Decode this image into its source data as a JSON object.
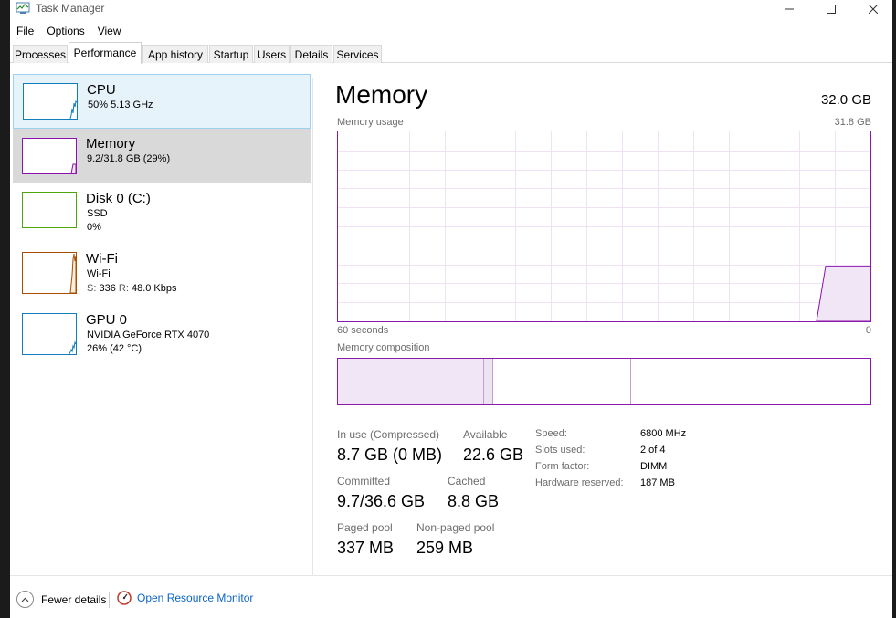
{
  "window": {
    "title": "Task Manager",
    "controls": [
      "minimize",
      "maximize",
      "close"
    ]
  },
  "menu": [
    "File",
    "Options",
    "View"
  ],
  "tabs": [
    "Processes",
    "Performance",
    "App history",
    "Startup",
    "Users",
    "Details",
    "Services"
  ],
  "active_tab": "Performance",
  "resources": [
    {
      "name": "CPU",
      "line1": "50%  5.13 GHz",
      "line2": "",
      "color": "#117dbb"
    },
    {
      "name": "Memory",
      "line1": "9.2/31.8 GB (29%)",
      "line2": "",
      "color": "#8b12ae"
    },
    {
      "name": "Disk 0 (C:)",
      "line1": "SSD",
      "line2": "0%",
      "color": "#4da60c"
    },
    {
      "name": "Wi-Fi",
      "line1": "Wi-Fi",
      "line2_s": "S:",
      "line2_sv": "336",
      "line2_r": "R:",
      "line2_rv": "48.0 Kbps",
      "color": "#a74f01"
    },
    {
      "name": "GPU 0",
      "line1": "NVIDIA GeForce RTX 4070",
      "line2": "26%  (42 °C)",
      "color": "#117dbb"
    }
  ],
  "memory": {
    "title": "Memory",
    "total": "32.0 GB",
    "usage_label": "Memory usage",
    "usage_max": "31.8 GB",
    "time_left": "60 seconds",
    "time_right": "0",
    "usage_fraction": 0.29,
    "composition_label": "Memory composition",
    "stats": {
      "in_use_label": "In use (Compressed)",
      "in_use_value": "8.7 GB (0 MB)",
      "available_label": "Available",
      "available_value": "22.6 GB",
      "committed_label": "Committed",
      "committed_value": "9.7/36.6 GB",
      "cached_label": "Cached",
      "cached_value": "8.8 GB",
      "paged_label": "Paged pool",
      "paged_value": "337 MB",
      "nonpaged_label": "Non-paged pool",
      "nonpaged_value": "259 MB"
    },
    "info": [
      {
        "label": "Speed:",
        "value": "6800 MHz"
      },
      {
        "label": "Slots used:",
        "value": "2 of 4"
      },
      {
        "label": "Form factor:",
        "value": "DIMM"
      },
      {
        "label": "Hardware reserved:",
        "value": "187 MB"
      }
    ]
  },
  "footer": {
    "fewer_details": "Fewer details",
    "open_resource_monitor": "Open Resource Monitor"
  },
  "colors": {
    "memory_accent": "#8b12ae",
    "link": "#0a64c8"
  }
}
